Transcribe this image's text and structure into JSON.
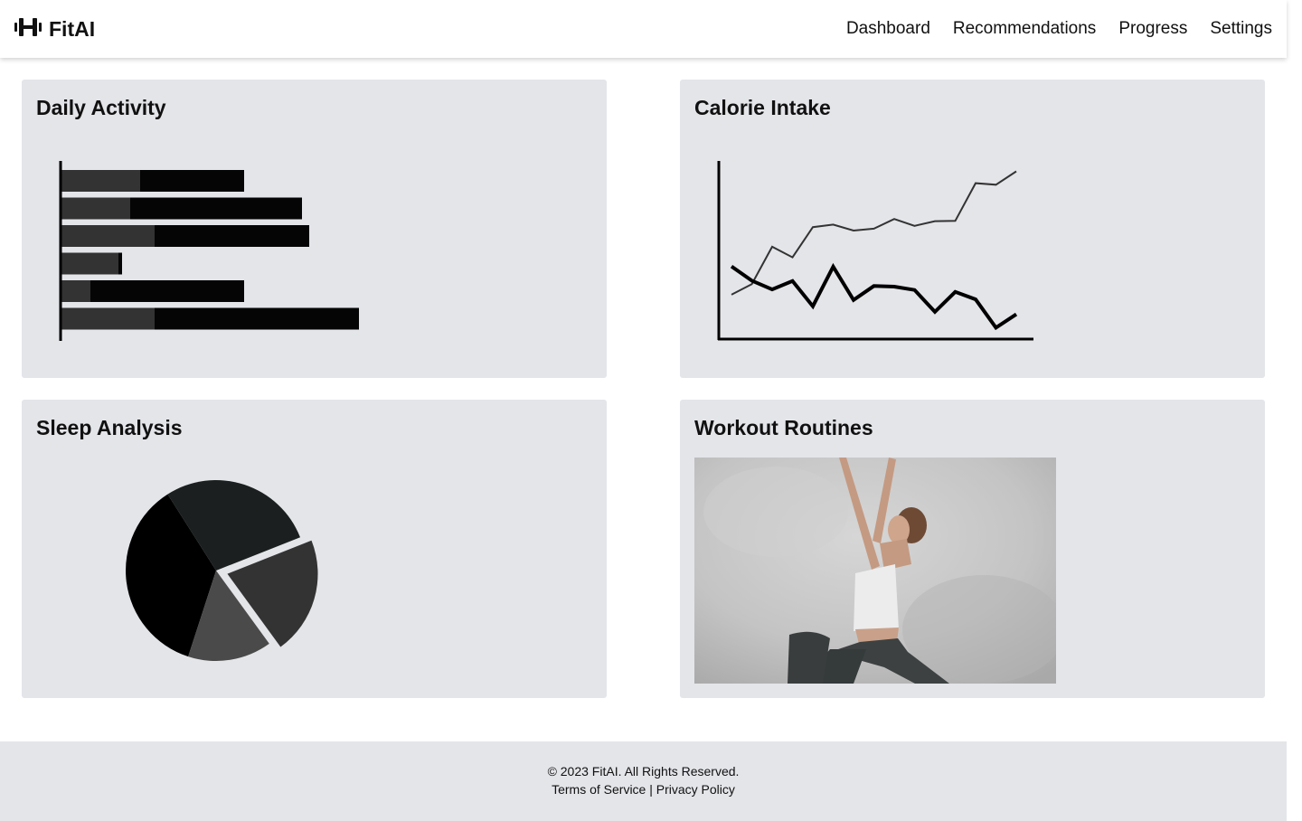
{
  "brand": {
    "name": "FitAI",
    "icon": "dumbbell-icon"
  },
  "nav": {
    "items": [
      {
        "label": "Dashboard"
      },
      {
        "label": "Recommendations"
      },
      {
        "label": "Progress"
      },
      {
        "label": "Settings"
      }
    ]
  },
  "cards": {
    "activity": {
      "title": "Daily Activity"
    },
    "calorie": {
      "title": "Calorie Intake"
    },
    "sleep": {
      "title": "Sleep Analysis"
    },
    "workout": {
      "title": "Workout Routines",
      "image": "woman in yoga warrior pose"
    }
  },
  "chart_data": [
    {
      "type": "bar",
      "stacked": true,
      "orientation": "horizontal",
      "title": "Daily Activity",
      "series": [
        {
          "color": "#333333",
          "values": [
            87,
            76,
            103,
            63,
            32,
            103
          ]
        },
        {
          "color": "#050505",
          "values": [
            115,
            190,
            171,
            4,
            170,
            226
          ]
        }
      ],
      "xlim": [
        0,
        360
      ]
    },
    {
      "type": "line",
      "title": "Calorie Intake",
      "x": [
        1,
        2,
        3,
        4,
        5,
        6,
        7,
        8,
        9,
        10,
        11,
        12,
        13,
        14
      ],
      "series": [
        {
          "color": "#333333",
          "values": [
            0.08,
            0.42,
            1.62,
            1.28,
            2.25,
            2.33,
            2.14,
            2.2,
            2.51,
            2.29,
            2.44,
            2.45,
            3.66,
            3.61,
            4.04
          ]
        },
        {
          "color": "#000000",
          "values": [
            0.99,
            0.53,
            0.25,
            0.52,
            -0.29,
            0.98,
            -0.09,
            0.36,
            0.34,
            0.23,
            -0.47,
            0.17,
            -0.07,
            -0.98,
            -0.55
          ]
        }
      ],
      "ylim": [
        -1.2,
        4.2
      ]
    },
    {
      "type": "pie",
      "title": "Sleep Analysis",
      "slices": [
        {
          "value": 36,
          "color": "#000000"
        },
        {
          "value": 28,
          "color": "#1b1f1f"
        },
        {
          "value": 21,
          "color": "#333333",
          "exploded": true
        },
        {
          "value": 15,
          "color": "#4a4a4a"
        }
      ]
    }
  ],
  "footer": {
    "copyright": "© 2023 FitAI. All Rights Reserved.",
    "terms": "Terms of Service",
    "separator": "|",
    "privacy": "Privacy Policy"
  }
}
